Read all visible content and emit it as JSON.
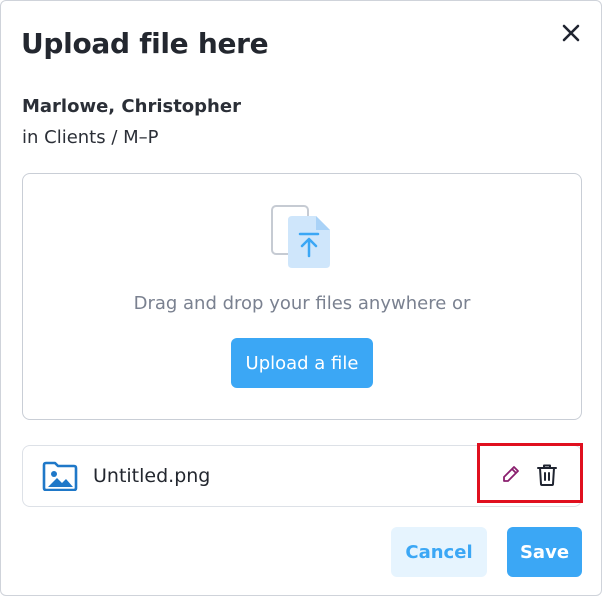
{
  "dialog": {
    "title": "Upload file here",
    "close_icon": "close-icon",
    "client_name": "Marlowe, Christopher",
    "client_path": "in Clients / M–P"
  },
  "dropzone": {
    "icon": "file-upload-icon",
    "instruction": "Drag and drop your files anywhere or",
    "upload_label": "Upload a file"
  },
  "file": {
    "icon": "image-file-icon",
    "name": "Untitled.png",
    "edit_icon": "pencil-icon",
    "delete_icon": "trash-icon"
  },
  "footer": {
    "cancel_label": "Cancel",
    "save_label": "Save"
  },
  "colors": {
    "accent": "#3ba7f5",
    "accent_light": "#e6f4fe",
    "highlight": "#e0101f",
    "edit_icon": "#8a1f6e"
  }
}
